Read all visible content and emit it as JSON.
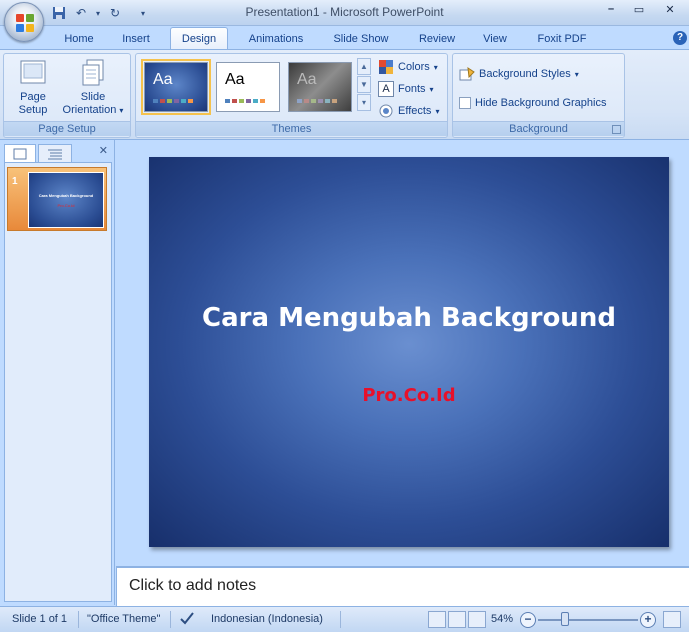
{
  "window": {
    "title": "Presentation1 - Microsoft PowerPoint"
  },
  "ribbon_tabs": [
    {
      "label": "Home"
    },
    {
      "label": "Insert"
    },
    {
      "label": "Design"
    },
    {
      "label": "Animations"
    },
    {
      "label": "Slide Show"
    },
    {
      "label": "Review"
    },
    {
      "label": "View"
    },
    {
      "label": "Foxit PDF"
    }
  ],
  "active_tab": "Design",
  "groups": {
    "page_setup": {
      "label": "Page Setup",
      "page_setup_line1": "Page",
      "page_setup_line2": "Setup",
      "slide_orientation_line1": "Slide",
      "slide_orientation_line2": "Orientation"
    },
    "themes": {
      "label": "Themes",
      "thumbnail_text": "Aa",
      "colors": "Colors",
      "fonts": "Fonts",
      "effects": "Effects"
    },
    "background": {
      "label": "Background",
      "background_styles": "Background Styles",
      "hide_background_graphics": "Hide Background Graphics",
      "hide_background_graphics_checked": false
    }
  },
  "slides_pane": {
    "slide_number": "1"
  },
  "slide": {
    "title": "Cara Mengubah Background",
    "subtitle": "Pro.Co.Id"
  },
  "notes": {
    "placeholder": "Click to add notes"
  },
  "status_bar": {
    "slide_indicator": "Slide 1 of 1",
    "theme": "\"Office Theme\"",
    "language": "Indonesian (Indonesia)",
    "zoom": "54%"
  },
  "colors": {
    "ribbon_bg": "#bfdbff",
    "subtitle_red": "#e8102a",
    "selection_orange": "#e8893a"
  }
}
